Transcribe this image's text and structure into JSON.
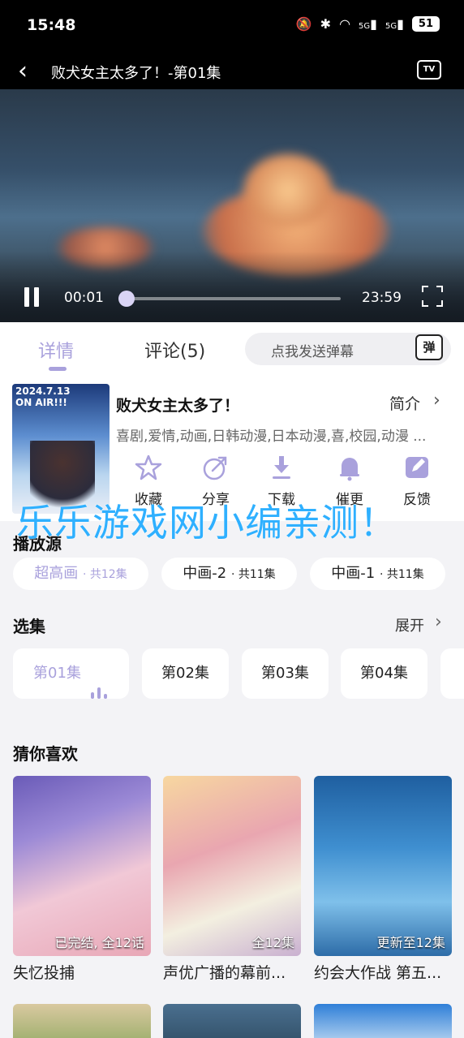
{
  "status_bar": {
    "time": "15:48",
    "battery": "51",
    "signal1": "5G",
    "signal2": "5G"
  },
  "top_bar": {
    "title": "败犬女主太多了！-第01集"
  },
  "player": {
    "current_time": "00:01",
    "duration": "23:59",
    "progress": 0.0007
  },
  "tabs": {
    "details": "详情",
    "comments": "评论(5)",
    "danmu_placeholder": "点我发送弹幕",
    "danmu_icon": "弹"
  },
  "poster_text": "2024.7.13\nON AIR!!!",
  "show": {
    "title": "败犬女主太多了！",
    "intro_label": "简介",
    "tags": "喜剧,爱情,动画,日韩动漫,日本动漫,喜,校园,动漫 ..."
  },
  "actions": [
    {
      "label": "收藏",
      "icon": "star-icon"
    },
    {
      "label": "分享",
      "icon": "share-icon"
    },
    {
      "label": "下载",
      "icon": "download-icon"
    },
    {
      "label": "催更",
      "icon": "bell-icon"
    },
    {
      "label": "反馈",
      "icon": "feedback-icon"
    }
  ],
  "watermark": "乐乐游戏网小编亲测！",
  "sources": {
    "title": "播放源",
    "items": [
      {
        "name": "超高画",
        "count": "· 共12集",
        "active": true
      },
      {
        "name": "中画-2",
        "count": "· 共11集",
        "active": false
      },
      {
        "name": "中画-1",
        "count": "· 共11集",
        "active": false
      }
    ]
  },
  "episodes": {
    "title": "选集",
    "expand": "展开",
    "items": [
      "第01集",
      "第02集",
      "第03集",
      "第04集"
    ]
  },
  "recommend": {
    "title": "猜你喜欢",
    "items": [
      {
        "title": "失忆投捕",
        "badge": "已完结, 全12话"
      },
      {
        "title": "声优广播的幕前...",
        "badge": "全12集"
      },
      {
        "title": "约会大作战 第五...",
        "badge": "更新至12集"
      }
    ]
  },
  "colors": {
    "accent": "#a9a1dc",
    "watermark": "#2fb0ff",
    "background": "#f3f3f6"
  }
}
